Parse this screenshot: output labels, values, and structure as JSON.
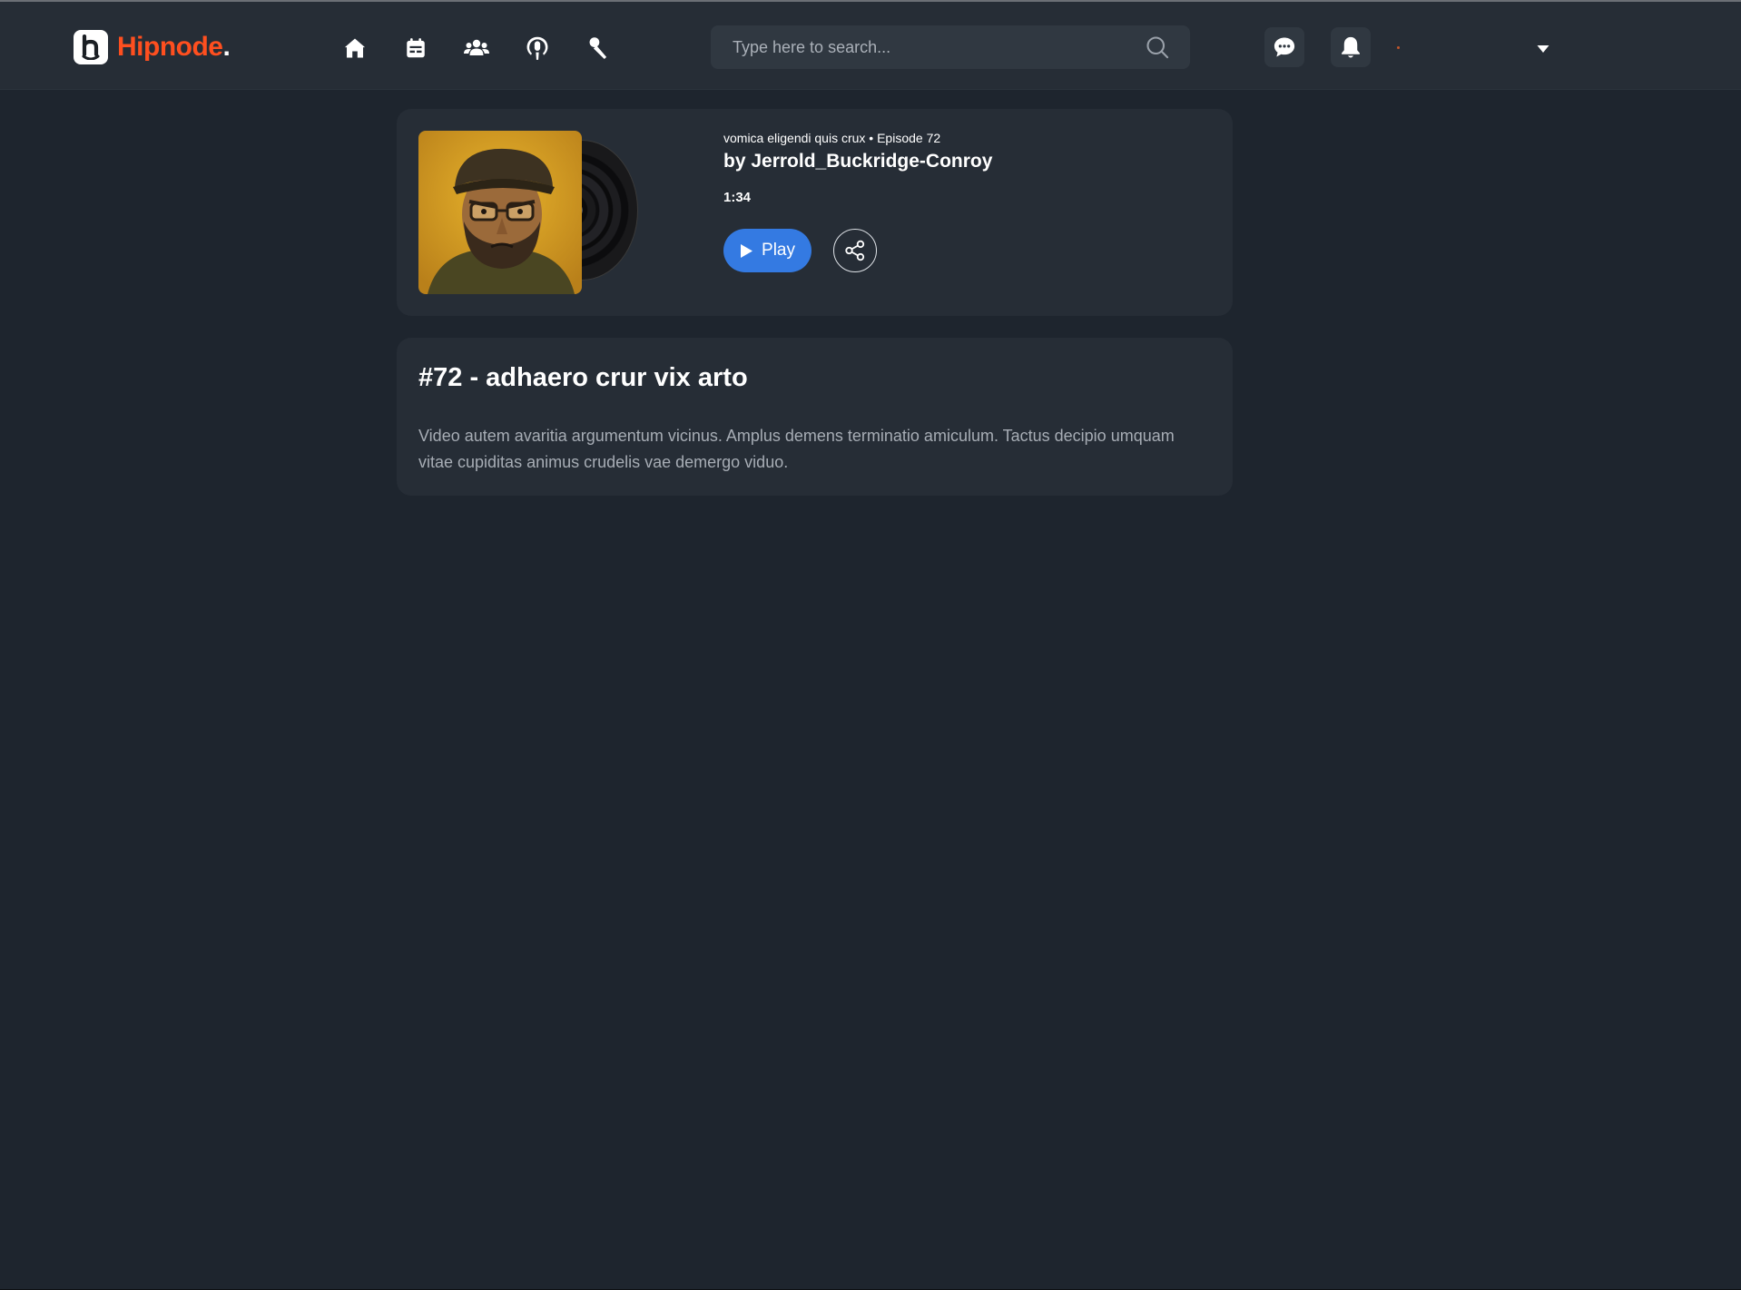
{
  "header": {
    "logo": {
      "mark_letter": "b",
      "name": "Hipnode",
      "dot": "."
    },
    "nav": [
      {
        "id": "home",
        "icon": "home-icon"
      },
      {
        "id": "calendar",
        "icon": "calendar-icon"
      },
      {
        "id": "groups",
        "icon": "groups-icon"
      },
      {
        "id": "podcasts",
        "icon": "podcast-icon"
      },
      {
        "id": "interviews",
        "icon": "microphone-icon"
      }
    ],
    "search": {
      "placeholder": "Type here to search...",
      "icon": "search-icon"
    },
    "messages_icon": "message-icon",
    "notifications_icon": "bell-icon",
    "dropdown_icon": "chevron-down-icon"
  },
  "episode": {
    "show_line": "vomica eligendi quis crux • Episode 72",
    "author": "by Jerrold_Buckridge-Conroy",
    "duration": "1:34",
    "play_label": "Play",
    "play_icon": "play-icon",
    "share_icon": "share-icon",
    "cover_icon": "podcast-cover-image",
    "title": "#72 - adhaero crur vix arto",
    "description": "Video autem avaritia argumentum vicinus. Amplus demens terminatio amiculum. Tactus decipio umquam vitae cupiditas animus crudelis vae demergo viduo."
  },
  "colors": {
    "background": "#1e252e",
    "surface": "#262d36",
    "brand": "#ff4f1f",
    "accent": "#347ae2",
    "muted_text": "#a7adb5"
  }
}
